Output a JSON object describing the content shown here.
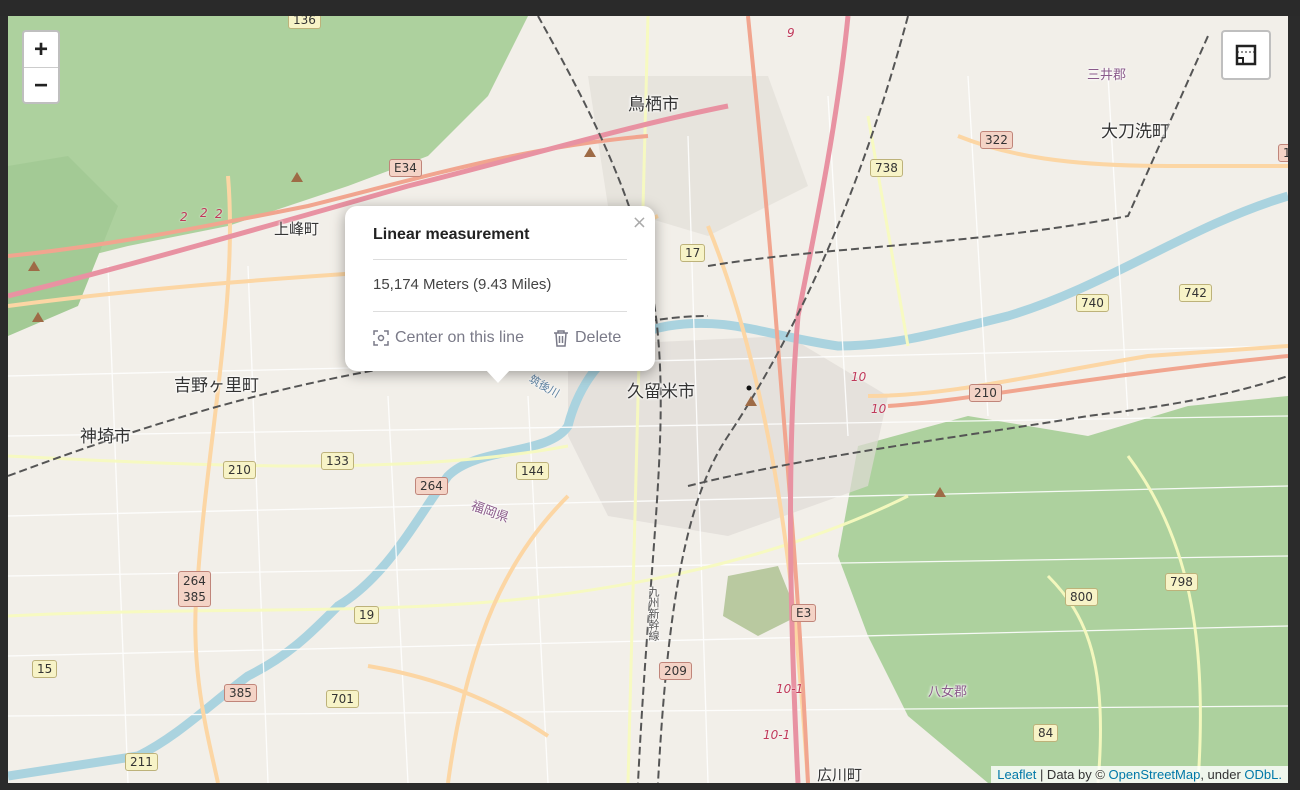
{
  "map": {
    "zoom_in_label": "+",
    "zoom_out_label": "−",
    "measure_control_icon": "ruler-square-icon",
    "colors": {
      "land": "#f2efe9",
      "forest": "#add19e",
      "water": "#aad3df",
      "motorway": "#e892a2",
      "primary": "#fcd6a4",
      "secondary": "#f7fabf",
      "railway": "#555555"
    }
  },
  "labels": {
    "cities": [
      "鳥栖市",
      "久留米市",
      "神埼市",
      "吉野ヶ里町",
      "上峰町",
      "大刀洗町",
      "広川町"
    ],
    "districts": [
      "三井郡",
      "八女郡",
      "福岡県"
    ],
    "railway_label": "九州新幹線",
    "river_label": "筑後川"
  },
  "shields": {
    "yellow": [
      "136",
      "738",
      "17",
      "740",
      "742",
      "133",
      "144",
      "210",
      "800",
      "798",
      "19",
      "701",
      "211",
      "84",
      "15"
    ],
    "red": [
      "E34",
      "322",
      "210",
      "264",
      "264\n385",
      "385",
      "209",
      "E3",
      "1"
    ]
  },
  "route_numbers": [
    "9",
    "2",
    "2",
    "2",
    "10",
    "10",
    "10-1",
    "10-1"
  ],
  "popup": {
    "title": "Linear measurement",
    "result": "15,174 Meters (9.43 Miles)",
    "center_label": "Center on this line",
    "delete_label": "Delete",
    "close_label": "×",
    "center_icon": "crosshair-focus-icon",
    "delete_icon": "trash-icon"
  },
  "attribution": {
    "leaflet": "Leaflet",
    "sep1": " | Data by © ",
    "osm": "OpenStreetMap",
    "sep2": ", under ",
    "odbl": "ODbL."
  }
}
